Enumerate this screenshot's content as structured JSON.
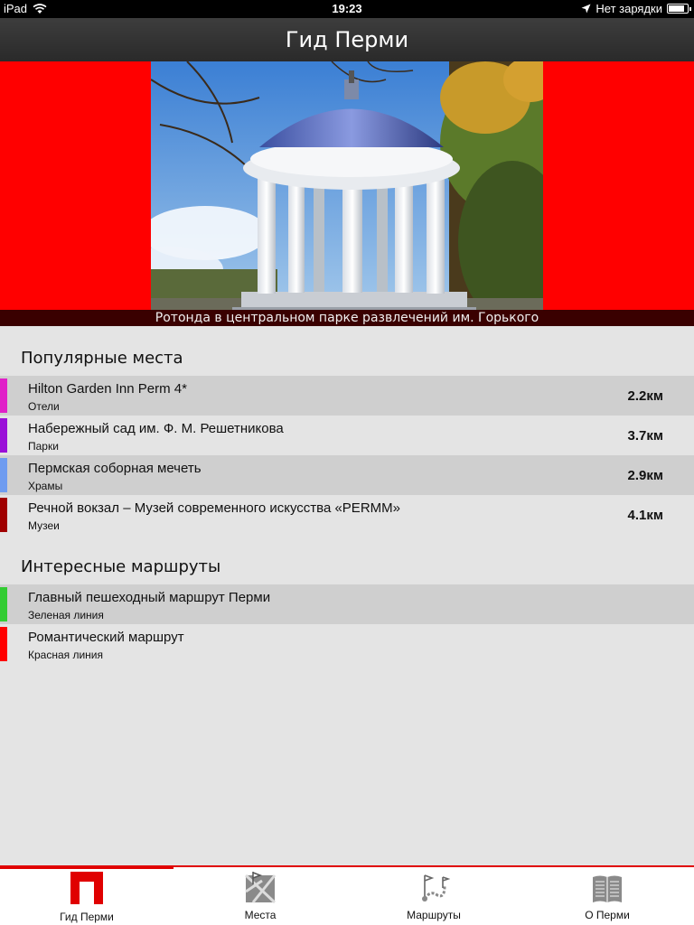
{
  "status": {
    "device": "iPad",
    "time": "19:23",
    "charging_text": "Нет зарядки",
    "battery_level": 0.85
  },
  "nav": {
    "title": "Гид Перми"
  },
  "banner": {
    "caption": "Ротонда в центральном парке развлечений им. Горького"
  },
  "popular": {
    "title": "Популярные места",
    "items": [
      {
        "title": "Hilton Garden Inn Perm 4*",
        "category": "Отели",
        "distance": "2.2км",
        "color": "#e020c8"
      },
      {
        "title": "Набережный сад им. Ф. М. Решетникова",
        "category": "Парки",
        "distance": "3.7км",
        "color": "#9a10d8"
      },
      {
        "title": "Пермская соборная мечеть",
        "category": "Храмы",
        "distance": "2.9км",
        "color": "#6f9cf0"
      },
      {
        "title": "Речной вокзал – Музей современного искусства «PERMM»",
        "category": "Музеи",
        "distance": "4.1км",
        "color": "#a00000"
      }
    ]
  },
  "routes": {
    "title": "Интересные маршруты",
    "items": [
      {
        "title": "Главный пешеходный маршрут Перми",
        "category": "Зеленая линия",
        "color": "#33cc33"
      },
      {
        "title": "Романтический маршрут",
        "category": "Красная линия",
        "color": "#ff0000"
      }
    ]
  },
  "tabs": [
    {
      "label": "Гид Перми",
      "icon": "guide-icon",
      "active": true
    },
    {
      "label": "Места",
      "icon": "map-icon",
      "active": false
    },
    {
      "label": "Маршруты",
      "icon": "routes-icon",
      "active": false
    },
    {
      "label": "О Перми",
      "icon": "book-icon",
      "active": false
    }
  ],
  "colors": {
    "accent": "#e00000",
    "banner": "#ff0000"
  }
}
